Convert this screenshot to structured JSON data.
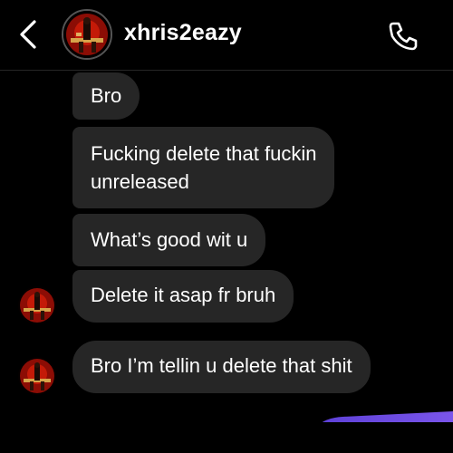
{
  "header": {
    "username": "xhris2eazy",
    "back_icon": "chevron-left-icon",
    "call_icon": "phone-icon"
  },
  "messages": [
    {
      "text": "Bro"
    },
    {
      "text_line1": "Fucking delete that fuckin",
      "text_line2": "unreleased"
    },
    {
      "text": "What’s good wit u"
    },
    {
      "text": "Delete it asap fr bruh"
    },
    {
      "text": "Bro I’m tellin u delete that shit"
    }
  ],
  "colors": {
    "background": "#000000",
    "received_bubble": "#262626",
    "sent_bubble_accent": "#6a4fe0"
  }
}
